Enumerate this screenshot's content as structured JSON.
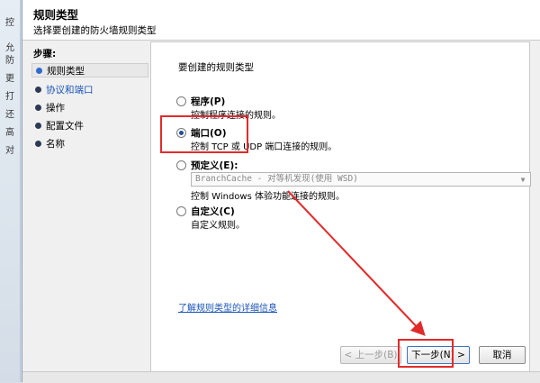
{
  "background_window": {
    "sidebar_chars": [
      "控",
      "允",
      "防",
      "更",
      "打",
      "还",
      "高",
      "对"
    ]
  },
  "dialog": {
    "title": "规则类型",
    "subtitle": "选择要创建的防火墙规则类型"
  },
  "steps": {
    "label": "步骤:",
    "items": [
      {
        "label": "规则类型",
        "active": true
      },
      {
        "label": "协议和端口",
        "active": false,
        "link": true
      },
      {
        "label": "操作",
        "active": false
      },
      {
        "label": "配置文件",
        "active": false
      },
      {
        "label": "名称",
        "active": false
      }
    ]
  },
  "content": {
    "prompt": "要创建的规则类型",
    "options": [
      {
        "title": "程序(P)",
        "desc": "控制程序连接的规则。",
        "selected": false
      },
      {
        "title": "端口(O)",
        "desc": "控制 TCP 或 UDP 端口连接的规则。",
        "selected": true
      },
      {
        "title": "预定义(E):",
        "desc": "控制 Windows 体验功能连接的规则。",
        "selected": false
      },
      {
        "title": "自定义(C)",
        "desc": "自定义规则。",
        "selected": false
      }
    ],
    "predefined_value": "BranchCache - 对等机发现(使用 WSD)",
    "learn_more": "了解规则类型的详细信息"
  },
  "buttons": {
    "back": "< 上一步(B)",
    "next": "下一步(N) >",
    "cancel": "取消"
  },
  "colors": {
    "annotation_red": "#e12b2b",
    "link_blue": "#1a55b8"
  }
}
